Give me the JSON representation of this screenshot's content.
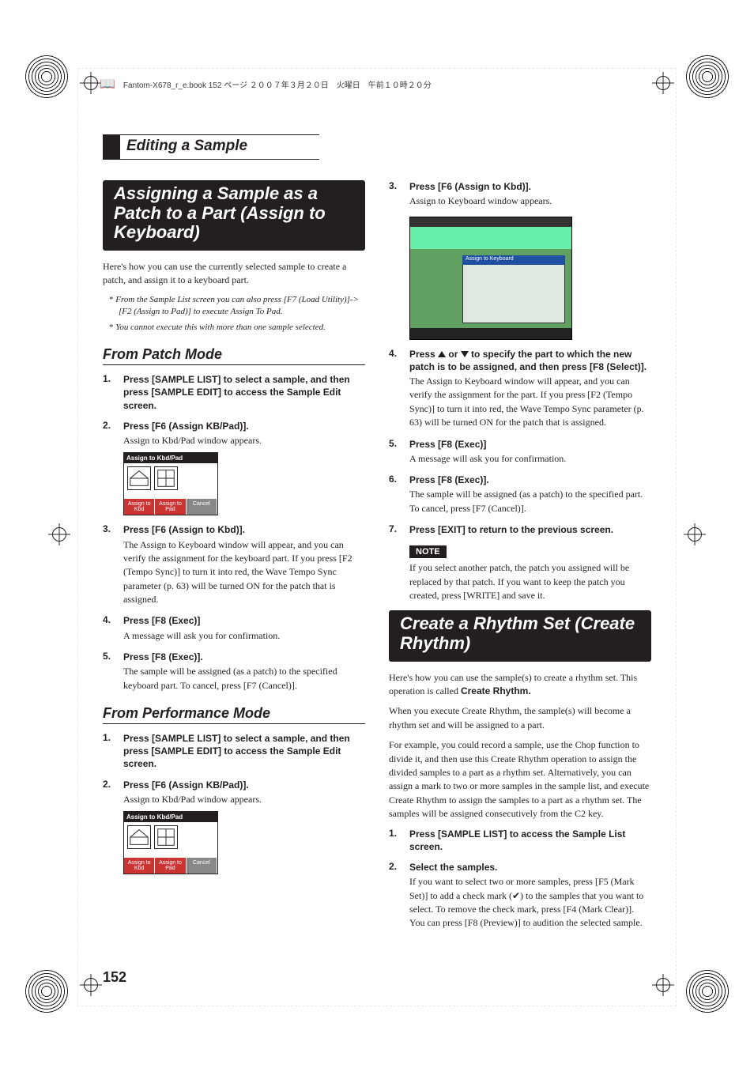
{
  "topline": "Fantom-X678_r_e.book  152 ページ  ２００７年３月２０日　火曜日　午前１０時２０分",
  "section_title": "Editing a Sample",
  "page_number": "152",
  "left": {
    "h1": "Assigning a Sample as a Patch to a Part (Assign to Keyboard)",
    "intro": "Here's how you can use the currently selected sample to create a patch, and assign it to a keyboard part.",
    "starnotes": [
      "From the Sample List screen you can also press [F7 (Load Utility)]-> [F2 (Assign to Pad)] to execute Assign To Pad.",
      "You cannot execute this with more than one sample selected."
    ],
    "h2a": "From Patch Mode",
    "steps_patch": [
      {
        "title": "Press [SAMPLE LIST] to select a sample, and then press [SAMPLE EDIT] to access the Sample Edit screen."
      },
      {
        "title": "Press [F6 (Assign KB/Pad)].",
        "body": "Assign to Kbd/Pad window appears."
      },
      {
        "title": "Press [F6 (Assign to Kbd)].",
        "body": "The Assign to Keyboard window will appear, and you can verify the assignment for the keyboard part.\nIf you press [F2 (Tempo Sync)] to turn it into red, the Wave Tempo Sync parameter (p. 63) will be turned ON for the patch that is assigned."
      },
      {
        "title": "Press [F8 (Exec)]",
        "body": "A message will ask you for confirmation."
      },
      {
        "title": "Press [F8 (Exec)].",
        "body": "The sample will be assigned (as a patch) to the specified keyboard part.\nTo cancel, press [F7 (Cancel)]."
      }
    ],
    "h2b": "From Performance Mode",
    "steps_perf": [
      {
        "title": "Press [SAMPLE LIST] to select a sample, and then press [SAMPLE EDIT] to access the Sample Edit screen."
      },
      {
        "title": "Press [F6 (Assign KB/Pad)].",
        "body": "Assign to Kbd/Pad window appears."
      }
    ],
    "screenshot": {
      "bar": "Assign to Kbd/Pad",
      "tabs": [
        "Assign to Kbd",
        "Assign to Pad",
        "Cancel"
      ]
    }
  },
  "right": {
    "steps_cont": [
      {
        "n": "3",
        "title": "Press [F6 (Assign to Kbd)].",
        "body": "Assign to Keyboard window appears."
      },
      {
        "n": "4",
        "title_pre": "Press  ",
        "title_mid": "  or  ",
        "title_post": "  to specify the part to which the new patch is to be assigned, and then press [F8 (Select)].",
        "body": "The Assign to Keyboard window will appear, and you can verify the assignment for the part.\nIf you press [F2 (Tempo Sync)] to turn it into red, the Wave Tempo Sync parameter (p. 63) will be turned ON for the patch that is assigned."
      },
      {
        "n": "5",
        "title": "Press [F8 (Exec)]",
        "body": "A message will ask you for confirmation."
      },
      {
        "n": "6",
        "title": "Press [F8 (Exec)].",
        "body": "The sample will be assigned (as a patch) to the specified part.\nTo cancel, press [F7 (Cancel)]."
      },
      {
        "n": "7",
        "title": "Press [EXIT] to return to the previous screen."
      }
    ],
    "screenshot_header": "Assign to Keyboard",
    "note_label": "NOTE",
    "note_body": "If you select another patch, the patch you assigned will be replaced by that patch. If you want to keep the patch you created, press [WRITE] and save it.",
    "h1": "Create a Rhythm Set (Create Rhythm)",
    "intro1_pre": "Here's how you can use the sample(s) to create a rhythm set. This operation is called ",
    "intro1_bold": "Create Rhythm.",
    "intro2": "When you execute Create Rhythm, the sample(s) will become a rhythm set and will be assigned to a part.",
    "intro3": "For example, you could record a sample, use the Chop function to divide it, and then use this Create Rhythm operation to assign the divided samples to a part as a rhythm set. Alternatively, you can assign a mark to two or more samples in the sample list, and execute Create Rhythm to assign the samples to a part as a rhythm set. The samples will be assigned consecutively from the C2 key.",
    "steps_rhythm": [
      {
        "title": "Press [SAMPLE LIST] to access the Sample List screen."
      },
      {
        "title": "Select the samples.",
        "body": "If you want to select two or more samples, press [F5 (Mark Set)] to add a check mark (✔) to the samples that you want to select. To remove the check mark, press [F4 (Mark Clear)].\nYou can press [F8 (Preview)] to audition the selected sample."
      }
    ]
  }
}
